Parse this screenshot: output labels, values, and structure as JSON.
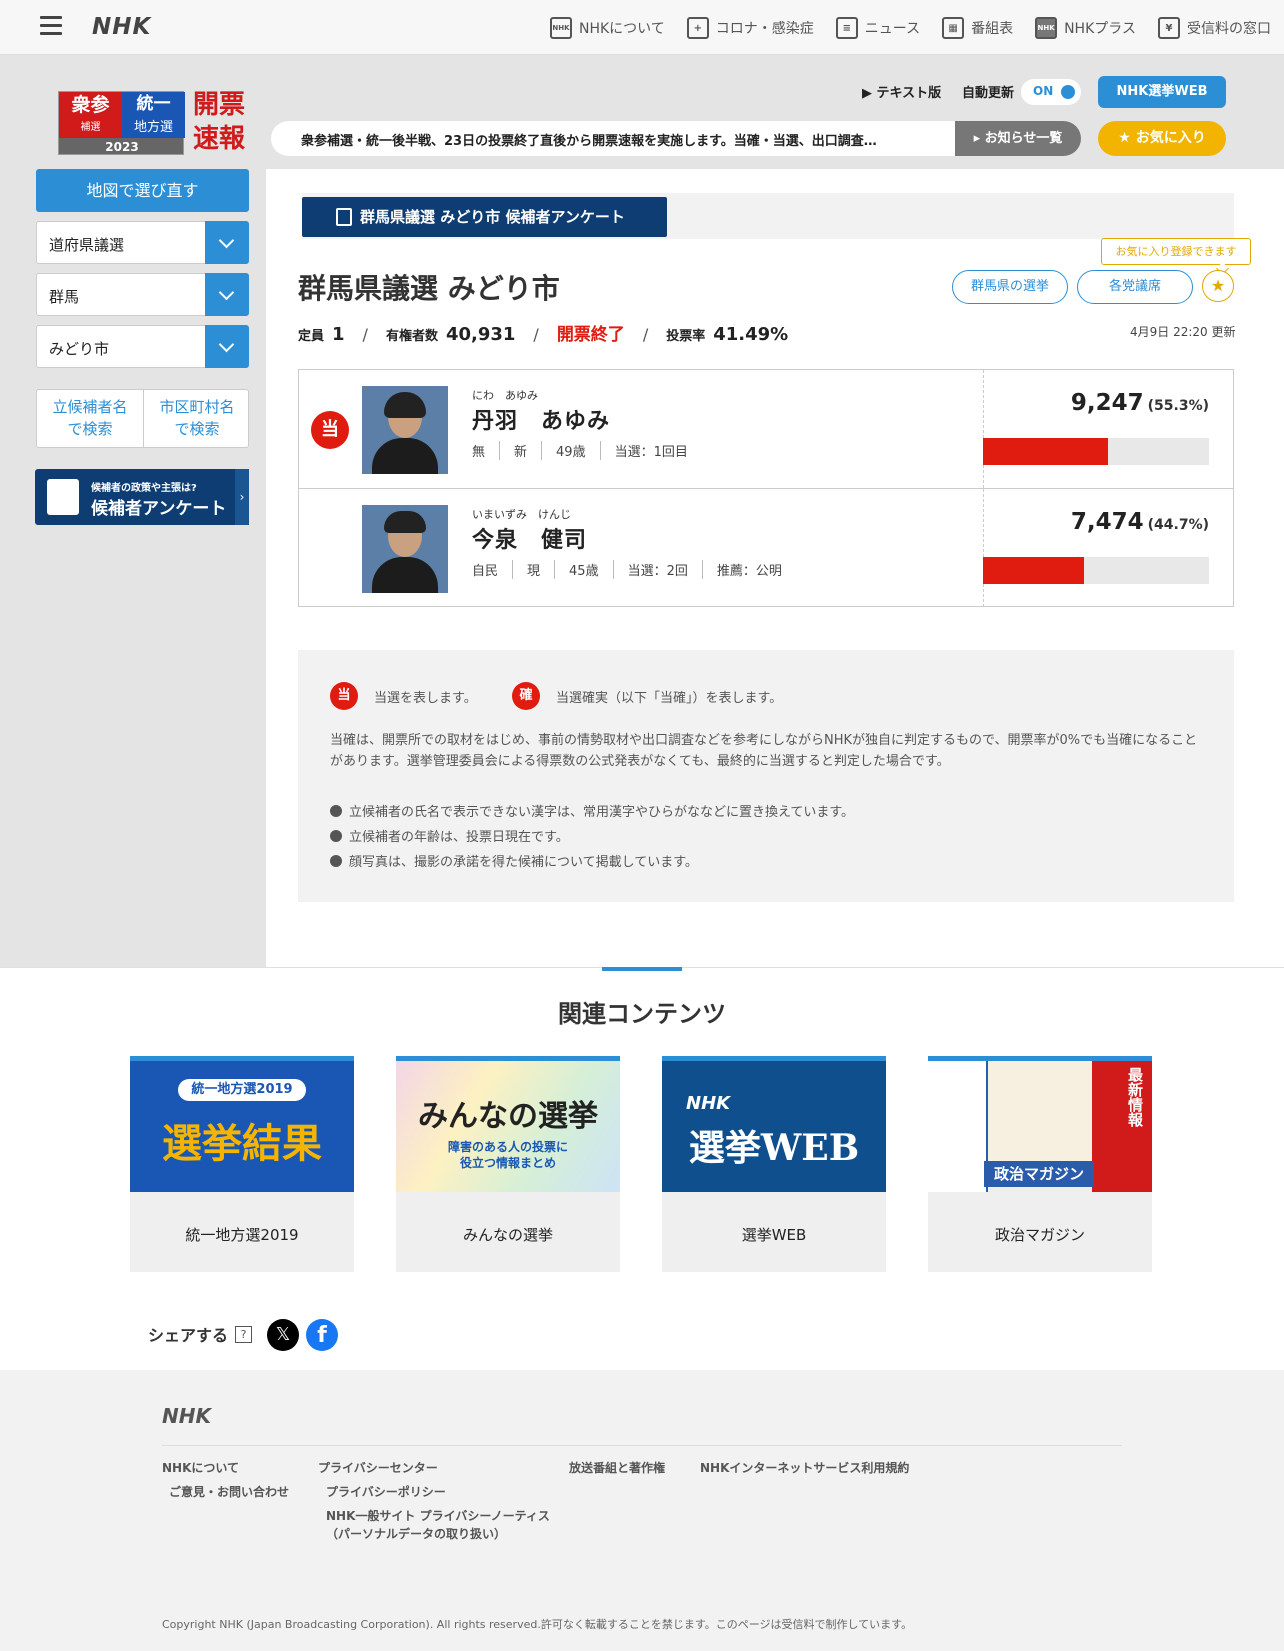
{
  "header": {
    "logo": "NHK",
    "nav": [
      {
        "icon": "nhk-icon",
        "glyph": "NHK",
        "label": "NHKについて"
      },
      {
        "icon": "corona-icon",
        "glyph": "+",
        "label": "コロナ・感染症"
      },
      {
        "icon": "news-icon",
        "glyph": "≡",
        "label": "ニュース"
      },
      {
        "icon": "program-guide-icon",
        "glyph": "▦",
        "label": "番組表"
      },
      {
        "icon": "nhk-plus-icon",
        "glyph": "NHK",
        "label": "NHKプラス"
      },
      {
        "icon": "reception-fee-icon",
        "glyph": "¥",
        "label": "受信料の窓口"
      }
    ]
  },
  "election_logo": {
    "left_top": "衆参",
    "left_bottom": "補選",
    "right_top": "統一",
    "right_bottom": "地方選",
    "year": "2023",
    "title_line1": "開票",
    "title_line2": "速報"
  },
  "controls": {
    "text_version": "▶ テキスト版",
    "auto_update": "自動更新",
    "toggle": "ON",
    "web_button": "NHK選挙WEB",
    "ticker": "衆参補選・統一後半戦、23日の投票終了直後から開票速報を実施します。当確・当選、出口調査…",
    "notices_button": "▸ お知らせ一覧",
    "favorite_button": "★ お気に入り"
  },
  "sidebar": {
    "map_button": "地図で選び直す",
    "selects": [
      "道府県議選",
      "群馬",
      "みどり市"
    ],
    "search_name": [
      "立候補者名",
      "で検索"
    ],
    "search_city": [
      "市区町村名",
      "で検索"
    ],
    "survey_small": "候補者の政策や主張は?",
    "survey_big": "候補者アンケート",
    "survey_arrow": "›"
  },
  "main": {
    "survey_tab": "群馬県議選 みどり市 候補者アンケート",
    "fav_tip": "お気に入り登録できます",
    "title": "群馬県議選 みどり市",
    "pill_prefecture": "群馬県の選挙",
    "pill_parties": "各党議席",
    "star": "★",
    "stats": {
      "seats_label": "定員",
      "seats": "1",
      "sep": "/",
      "voters_label": "有権者数",
      "voters": "40,931",
      "status": "開票終了",
      "turnout_label": "投票率",
      "turnout": "41.49%"
    },
    "updated": "4月9日 22:20 更新"
  },
  "candidates": [
    {
      "badge": "当",
      "ruby": "にわ　あゆみ",
      "name": "丹羽　あゆみ",
      "meta": [
        "無",
        "新",
        "49歳",
        "当選：1回目"
      ],
      "votes": "9,247",
      "pct": "(55.3%)",
      "share": 0.553
    },
    {
      "badge": "",
      "ruby": "いまいずみ　けんじ",
      "name": "今泉　健司",
      "meta": [
        "自民",
        "現",
        "45歳",
        "当選：2回",
        "推薦：公明"
      ],
      "votes": "7,474",
      "pct": "(44.7%)",
      "share": 0.447
    }
  ],
  "legend": {
    "win_badge": "当",
    "win_text": "当選を表します。",
    "sure_badge": "確",
    "sure_text": "当選確実（以下「当確」）を表します。",
    "paragraph": "当確は、開票所での取材をはじめ、事前の情勢取材や出口調査などを参考にしながらNHKが独自に判定するもので、開票率が0%でも当確になることがあります。選挙管理委員会による得票数の公式発表がなくても、最終的に当選すると判定した場合です。",
    "bullets": [
      "立候補者の氏名で表示できない漢字は、常用漢字やひらがななどに置き換えています。",
      "立候補者の年齢は、投票日現在です。",
      "顔写真は、撮影の承諾を得た候補について掲載しています。"
    ]
  },
  "related": {
    "title": "関連コンテンツ",
    "cards": [
      {
        "label": "統一地方選2019",
        "img_top": "統一地方選2019",
        "img_main": "選挙結果",
        "bg": "#1a57b4"
      },
      {
        "label": "みんなの選挙",
        "img_top": "みんなの選挙",
        "img_main": "障害のある人の投票に役立つ情報まとめ",
        "bg": "#e9f2d0"
      },
      {
        "label": "選挙WEB",
        "img_top": "NHK",
        "img_main": "選挙WEB",
        "bg": "#0f4f8e"
      },
      {
        "label": "政治マガジン",
        "img_top": "最新情報",
        "img_main": "政治マガジン",
        "bg": "#2b5cab"
      }
    ]
  },
  "share": {
    "label": "シェアする",
    "help": "?",
    "x": "𝕏",
    "fb": "f"
  },
  "footer": {
    "logo": "NHK",
    "links": {
      "about": "NHKについて",
      "contact": "ご意見・お問い合わせ",
      "privacy_center": "プライバシーセンター",
      "privacy_policy": "プライバシーポリシー",
      "privacy_notice_1": "NHK一般サイト プライバシーノーティス",
      "privacy_notice_2": "（パーソナルデータの取り扱い）",
      "broadcast": "放送番組と著作権",
      "terms": "NHKインターネットサービス利用規約"
    },
    "copyright": "Copyright NHK (Japan Broadcasting Corporation). All rights reserved.許可なく転載することを禁じます。このページは受信料で制作しています。"
  }
}
